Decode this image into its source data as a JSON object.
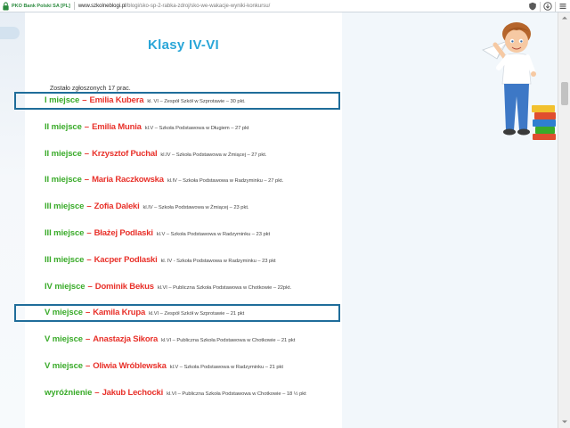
{
  "browser": {
    "certificate": "PKO Bank Polski SA [PL]",
    "url_domain": "www.szkolneblogi.pl",
    "url_path": "/blogi/sko-sp-2-rabka-zdroj/sko-we-wakacje-wyniki-konkursu/",
    "icons": [
      "shield-icon",
      "download-icon",
      "menu-icon"
    ]
  },
  "page": {
    "title": "Klasy IV-VI",
    "submission_count": "Zostało zgłoszonych 17 prac."
  },
  "results": [
    {
      "place": "I miejsce",
      "dash": "–",
      "name": "Emilia Kubera",
      "details": "kl. VI – Zespół Szkół w Szprotawie – 30 pkt."
    },
    {
      "place": "II miejsce",
      "dash": "–",
      "name": "Emilia Munia",
      "details": "kl.V – Szkoła Podstawowa w Długiem – 27 pkt"
    },
    {
      "place": "II miejsce",
      "dash": "–",
      "name": "Krzysztof Puchal",
      "details": "kl.IV – Szkoła Podstawowa w Żmiącej – 27 pkt."
    },
    {
      "place": "II miejsce",
      "dash": "–",
      "name": "Maria Raczkowska",
      "details": "kl.IV – Szkoła Podstawowa w Radzyminku – 27 pkt."
    },
    {
      "place": "III miejsce",
      "dash": "–",
      "name": "Zofia Daleki",
      "details": "kl.IV – Szkoła Podstawowa w Żmiącej – 23 pkt."
    },
    {
      "place": "III miejsce",
      "dash": "–",
      "name": "Błażej Podlaski",
      "details": "kl.V – Szkoła Podstawowa w Radzyminku – 23 pkt"
    },
    {
      "place": "III miejsce",
      "dash": "–",
      "name": "Kacper Podlaski",
      "details": "kl. IV -   Szkoła Podstawowa w Radzyminku – 23 pkt"
    },
    {
      "place": "IV miejsce",
      "dash": "–",
      "name": "Dominik Bekus",
      "details": "kl.VI – Publiczna Szkoła Podstawowa w Chotkowie – 22pkt."
    },
    {
      "place": "V miejsce",
      "dash": "–",
      "name": "Kamila Krupa",
      "details": "kl.VI – Zespół Szkół w Szprotawie – 21 pkt"
    },
    {
      "place": "V miejsce",
      "dash": "–",
      "name": "Anastazja Sikora",
      "details": "kl.VI – Publiczna Szkoła Podstawowa w Chotkowie – 21 pkt"
    },
    {
      "place": "V miejsce",
      "dash": "–",
      "name": "Oliwia Wróblewska",
      "details": "kl.V – Szkoła Podstawowa w Radzyminku – 21 pkt"
    },
    {
      "place": "wyróżnienie",
      "dash": "–",
      "name": "Jakub Lechocki",
      "details": "kl.VI – Publiczna Szkoła Podstawowa w Chotkowie – 18 ½ pkt"
    }
  ],
  "highlighted_rows": [
    0,
    8
  ],
  "colors": {
    "title": "#2aa6d8",
    "place": "#3aab2a",
    "name": "#e8312a",
    "highlight_border": "#1f6d9a"
  }
}
